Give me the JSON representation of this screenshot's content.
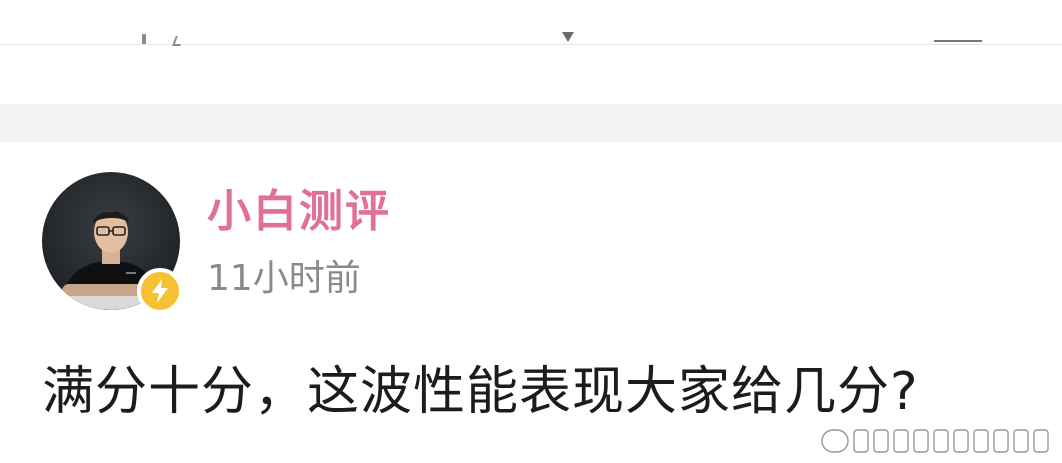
{
  "author": {
    "name": "小白测评",
    "time": "11小时前",
    "badge_icon": "lightning-icon"
  },
  "post": {
    "text": "满分十分，这波性能表现大家给几分?"
  },
  "colors": {
    "author_name": "#e0709a",
    "time": "#8a8a8a",
    "badge": "#f6c233",
    "band": "#f1f2f4"
  }
}
